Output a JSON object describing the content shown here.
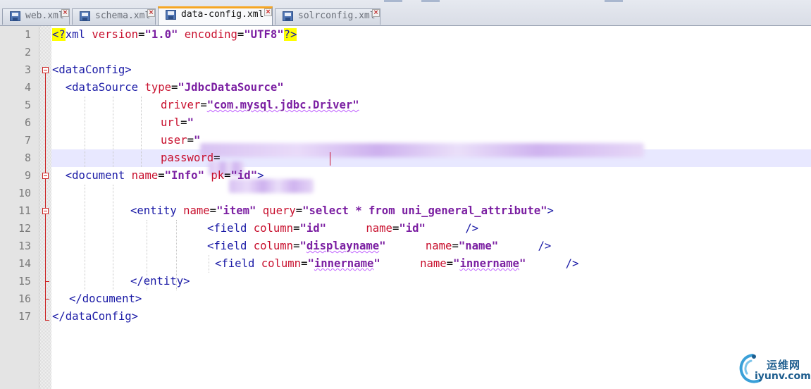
{
  "tabs": [
    {
      "label": "web.xml",
      "active": false
    },
    {
      "label": "schema.xml",
      "active": false
    },
    {
      "label": "data-config.xml",
      "active": true
    },
    {
      "label": "solrconfig.xml",
      "active": false
    }
  ],
  "close_glyph": "×",
  "gutter": {
    "line_numbers": [
      "1",
      "2",
      "3",
      "4",
      "5",
      "6",
      "7",
      "8",
      "9",
      "10",
      "11",
      "12",
      "13",
      "14",
      "15",
      "16",
      "17"
    ]
  },
  "code": {
    "l1": {
      "pi_open": "<?",
      "decl": "xml",
      "a1": "version",
      "eq": "=",
      "v1": "\"1.0\"",
      "a2": "encoding",
      "v2": "\"UTF8\"",
      "pi_close": "?>"
    },
    "l3": {
      "open": "<dataConfig>"
    },
    "l4": {
      "tag": "<dataSource",
      "attr": "type",
      "eq": "=",
      "val": "\"JdbcDataSource\""
    },
    "l5": {
      "attr": "driver",
      "eq": "=",
      "val": "\"com.mysql.jdbc.Driver\""
    },
    "l6": {
      "attr": "url",
      "eq": "=",
      "val": "\""
    },
    "l7": {
      "attr": "user",
      "eq": "=",
      "val": "\""
    },
    "l8": {
      "attr": "password",
      "eq": "="
    },
    "l9": {
      "tag": "<document",
      "a1": "name",
      "eq": "=",
      "v1": "\"Info\"",
      "a2": "pk",
      "v2": "\"id\"",
      "close": ">"
    },
    "l11": {
      "tag": "<entity",
      "a1": "name",
      "eq": "=",
      "v1": "\"item\"",
      "a2": "query",
      "v2": "\"select * from uni_general_attribute\"",
      "close": ">"
    },
    "l12": {
      "tag": "<field",
      "a1": "column",
      "eq": "=",
      "v1": "\"id\"",
      "a2": "name",
      "v2": "\"id\"",
      "close": "/>"
    },
    "l13": {
      "tag": "<field",
      "a1": "column",
      "eq": "=",
      "v1q": "\"",
      "v1w": "displayname",
      "v1e": "\"",
      "a2": "name",
      "v2": "\"name\"",
      "close": "/>"
    },
    "l14": {
      "tag": "<field",
      "a1": "column",
      "eq": "=",
      "v1q": "\"",
      "v1w": "innername",
      "v1e": "\"",
      "a2": "name",
      "v2q": "\"",
      "v2w": "innername",
      "v2e": "\"",
      "close": "/>"
    },
    "l15": {
      "close": "</entity>"
    },
    "l16": {
      "close": "</document>"
    },
    "l17": {
      "close": "</dataConfig>"
    }
  },
  "watermark": {
    "name": "运维网",
    "domain": "iyunv.com"
  },
  "colors": {
    "tag": "#1a1aa6",
    "attribute": "#c8102e",
    "string": "#7b1fa2",
    "pi_highlight": "#ffff00",
    "current_line": "#e8e8ff",
    "active_tab_accent": "#f6a623",
    "fold_marker": "#cc2222"
  }
}
